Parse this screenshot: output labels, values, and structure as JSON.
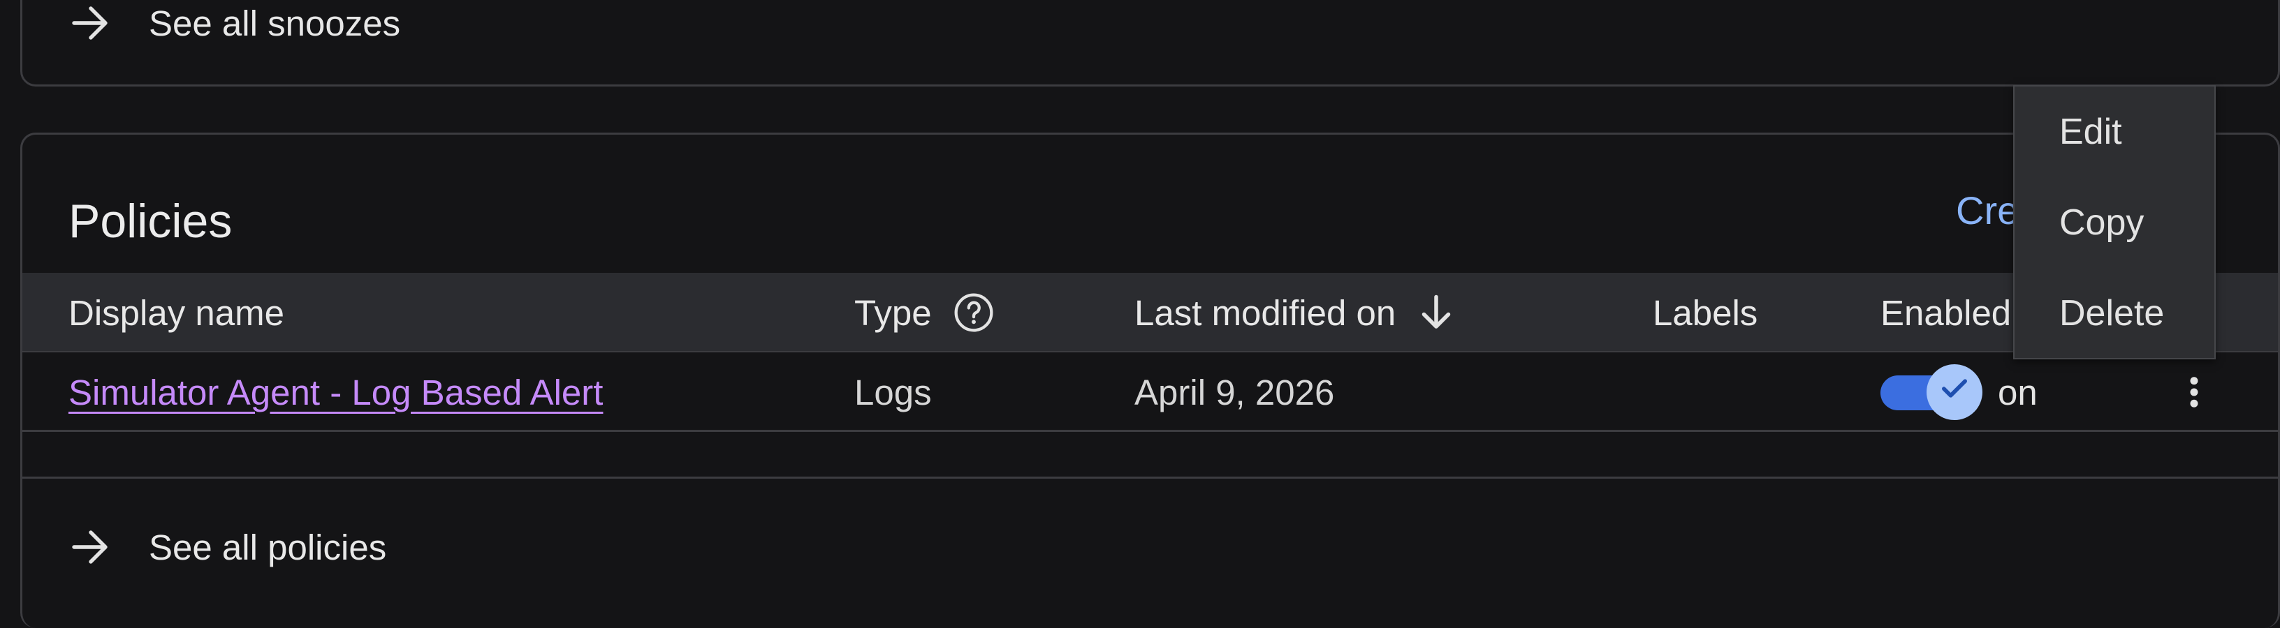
{
  "snoozes": {
    "see_all_label": "See all snoozes"
  },
  "policies": {
    "title": "Policies",
    "create_label": "Cre",
    "columns": {
      "display_name": "Display name",
      "type": "Type",
      "last_modified": "Last modified on",
      "labels": "Labels",
      "enabled": "Enabled"
    },
    "rows": [
      {
        "display_name": "Simulator Agent - Log Based Alert",
        "type": "Logs",
        "last_modified": "April 9, 2026",
        "labels": "",
        "enabled_label": "on"
      }
    ],
    "see_all_label": "See all policies"
  },
  "context_menu": {
    "items": [
      "Edit",
      "Copy",
      "Delete"
    ]
  },
  "colors": {
    "background": "#141416",
    "link_visited": "#c58af9",
    "link_action": "#8ab4f8",
    "toggle_track": "#3b6ee0",
    "toggle_thumb": "#a8c7fa"
  },
  "icons": {
    "see_all": "arrow-right-icon",
    "type_help": "help-circle-icon",
    "sort": "arrow-down-icon",
    "toggle_check": "check-icon",
    "row_menu": "more-vert-icon"
  }
}
